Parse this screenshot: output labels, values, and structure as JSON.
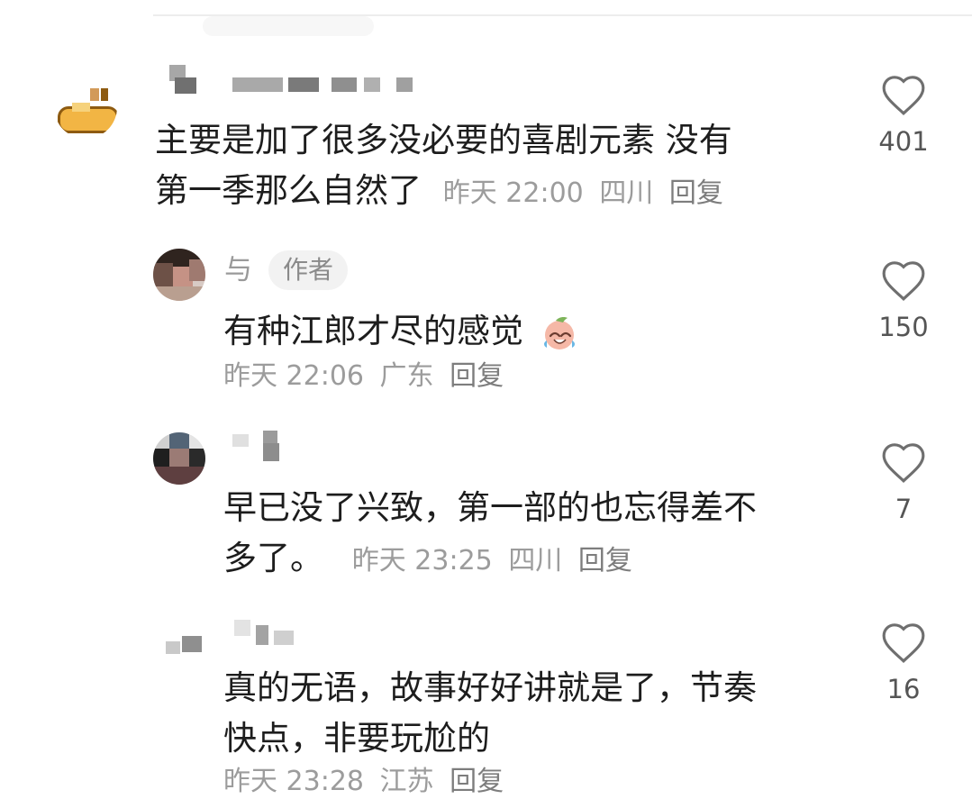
{
  "comments": [
    {
      "body": [
        "主要是加了很多没必要的喜剧元素 没有",
        "第一季那么自然了"
      ],
      "time": "昨天 22:00",
      "location": "四川",
      "reply_label": "回复",
      "likes": "401"
    },
    {
      "author": "与",
      "badge": "作者",
      "body": [
        "有种江郎才尽的感觉"
      ],
      "time": "昨天 22:06",
      "location": "广东",
      "reply_label": "回复",
      "likes": "150"
    },
    {
      "body": [
        "早已没了兴致，第一部的也忘得差不",
        "多了。"
      ],
      "time": "昨天 23:25",
      "location": "四川",
      "reply_label": "回复",
      "likes": "7"
    },
    {
      "body": [
        "真的无语，故事好好讲就是了，节奏",
        "快点，非要玩尬的"
      ],
      "time": "昨天 23:28",
      "location": "江苏",
      "reply_label": "回复",
      "likes": "16"
    }
  ],
  "icons": {
    "like": "heart-outline-icon",
    "emoji": "laugh-crying-peach-emoji"
  },
  "colors": {
    "text": "#1d1d1d",
    "meta": "#9c9c9c",
    "icon": "#6f6f6f",
    "badge_bg": "#f2f2f2"
  }
}
